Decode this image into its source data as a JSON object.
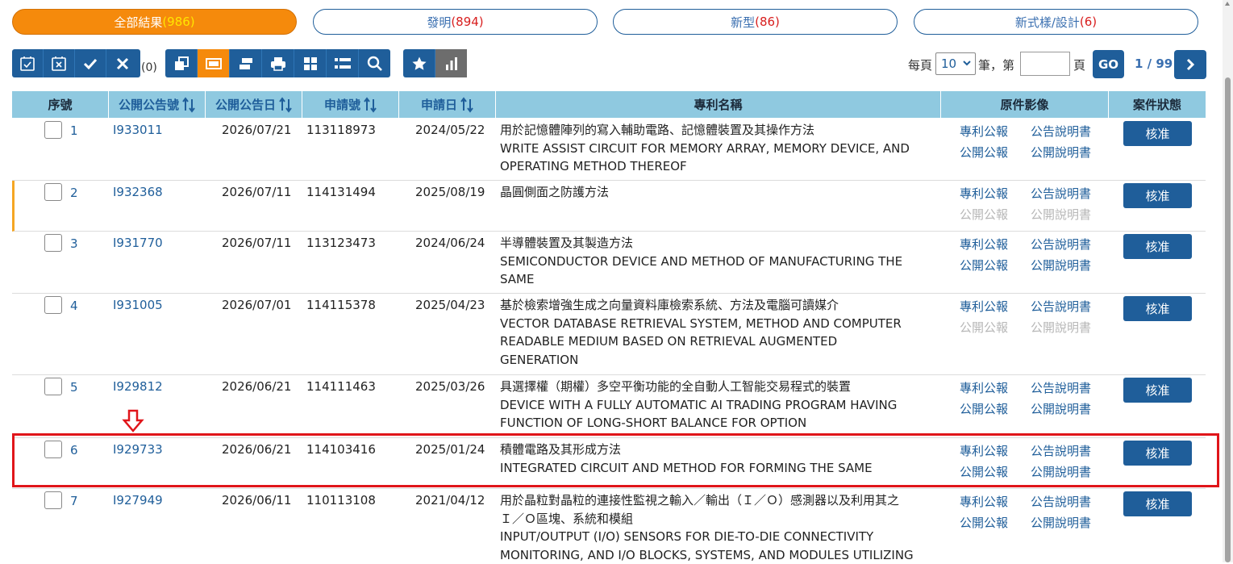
{
  "tabs": [
    {
      "label": "全部結果",
      "count": "(986)"
    },
    {
      "label": "發明",
      "count": "(894)"
    },
    {
      "label": "新型",
      "count": "(86)"
    },
    {
      "label": "新式樣/設計",
      "count": "(6)"
    }
  ],
  "toolbar": {
    "selected_count": "(0)",
    "icons": [
      "select-page-icon",
      "deselect-page-icon",
      "check-icon",
      "close-icon",
      "copy-icon",
      "single-view-icon",
      "list-view-icon",
      "print-icon",
      "grid-view-icon",
      "detail-list-icon",
      "search-icon",
      "star-icon",
      "chart-icon"
    ]
  },
  "pager": {
    "per_page_label": "每頁",
    "per_page_value": "10",
    "unit_label": "筆，第",
    "page_label": "頁",
    "go_label": "GO",
    "page_info": "1 / 99"
  },
  "table": {
    "headers": [
      "序號",
      "公開公告號",
      "公開公告日",
      "申請號",
      "申請日",
      "專利名稱",
      "原件影像",
      "案件狀態"
    ],
    "rows": [
      {
        "seq": "1",
        "pub_no": "I933011",
        "pub_date": "2026/07/21",
        "app_no": "113118973",
        "app_date": "2024/05/22",
        "title_lines": [
          "用於記憶體陣列的寫入輔助電路、記憶體裝置及其操作方法",
          "WRITE ASSIST CIRCUIT FOR MEMORY ARRAY, MEMORY DEVICE, AND",
          "OPERATING METHOD THEREOF"
        ],
        "links": [
          "專利公報",
          "公告說明書",
          "公開公報",
          "公開說明書"
        ],
        "disabled": [
          false,
          false,
          false,
          false
        ],
        "status": "核准"
      },
      {
        "seq": "2",
        "pub_no": "I932368",
        "pub_date": "2026/07/11",
        "app_no": "114131494",
        "app_date": "2025/08/19",
        "title_lines": [
          "晶圓側面之防護方法"
        ],
        "links": [
          "專利公報",
          "公告說明書",
          "公開公報",
          "公開說明書"
        ],
        "disabled": [
          false,
          false,
          true,
          true
        ],
        "status": "核准"
      },
      {
        "seq": "3",
        "pub_no": "I931770",
        "pub_date": "2026/07/11",
        "app_no": "113123473",
        "app_date": "2024/06/24",
        "title_lines": [
          "半導體裝置及其製造方法",
          "SEMICONDUCTOR DEVICE AND METHOD OF MANUFACTURING THE",
          "SAME"
        ],
        "links": [
          "專利公報",
          "公告說明書",
          "公開公報",
          "公開說明書"
        ],
        "disabled": [
          false,
          false,
          false,
          false
        ],
        "status": "核准"
      },
      {
        "seq": "4",
        "pub_no": "I931005",
        "pub_date": "2026/07/01",
        "app_no": "114115378",
        "app_date": "2025/04/23",
        "title_lines": [
          "基於檢索增強生成之向量資料庫檢索系統、方法及電腦可讀媒介",
          "VECTOR DATABASE RETRIEVAL SYSTEM, METHOD AND COMPUTER",
          "READABLE MEDIUM BASED ON RETRIEVAL AUGMENTED",
          "GENERATION"
        ],
        "links": [
          "專利公報",
          "公告說明書",
          "公開公報",
          "公開說明書"
        ],
        "disabled": [
          false,
          false,
          true,
          true
        ],
        "status": "核准"
      },
      {
        "seq": "5",
        "pub_no": "I929812",
        "pub_date": "2026/06/21",
        "app_no": "114111463",
        "app_date": "2025/03/26",
        "title_lines": [
          "具選擇權（期權）多空平衡功能的全自動人工智能交易程式的裝置",
          "DEVICE WITH A FULLY AUTOMATIC AI TRADING PROGRAM HAVING",
          "FUNCTION OF LONG-SHORT BALANCE FOR OPTION"
        ],
        "links": [
          "專利公報",
          "公告說明書",
          "公開公報",
          "公開說明書"
        ],
        "disabled": [
          false,
          false,
          false,
          false
        ],
        "status": "核准"
      },
      {
        "seq": "6",
        "pub_no": "I929733",
        "pub_date": "2026/06/21",
        "app_no": "114103416",
        "app_date": "2025/01/24",
        "title_lines": [
          "積體電路及其形成方法",
          "INTEGRATED CIRCUIT AND METHOD FOR FORMING THE SAME"
        ],
        "links": [
          "專利公報",
          "公告說明書",
          "公開公報",
          "公開說明書"
        ],
        "disabled": [
          false,
          false,
          false,
          false
        ],
        "status": "核准"
      },
      {
        "seq": "7",
        "pub_no": "I927949",
        "pub_date": "2026/06/11",
        "app_no": "110113108",
        "app_date": "2021/04/12",
        "title_lines": [
          "用於晶粒對晶粒的連接性監視之輸入／輸出（Ｉ／Ｏ）感測器以及利用其之",
          "Ｉ／Ｏ區塊、系統和模組",
          "INPUT/OUTPUT (I/O) SENSORS FOR DIE-TO-DIE CONNECTIVITY",
          "MONITORING, AND I/O BLOCKS, SYSTEMS, AND MODULES UTILIZING"
        ],
        "links": [
          "專利公報",
          "公告說明書",
          "公開公報",
          "公開說明書"
        ],
        "disabled": [
          false,
          false,
          false,
          false
        ],
        "status": "核准"
      }
    ]
  },
  "colors": {
    "primary": "#1f5e9a",
    "accent": "#f58a0c",
    "header_bg": "#8fc9e0",
    "highlight": "#e0151a",
    "count_red": "#d81e1e"
  }
}
